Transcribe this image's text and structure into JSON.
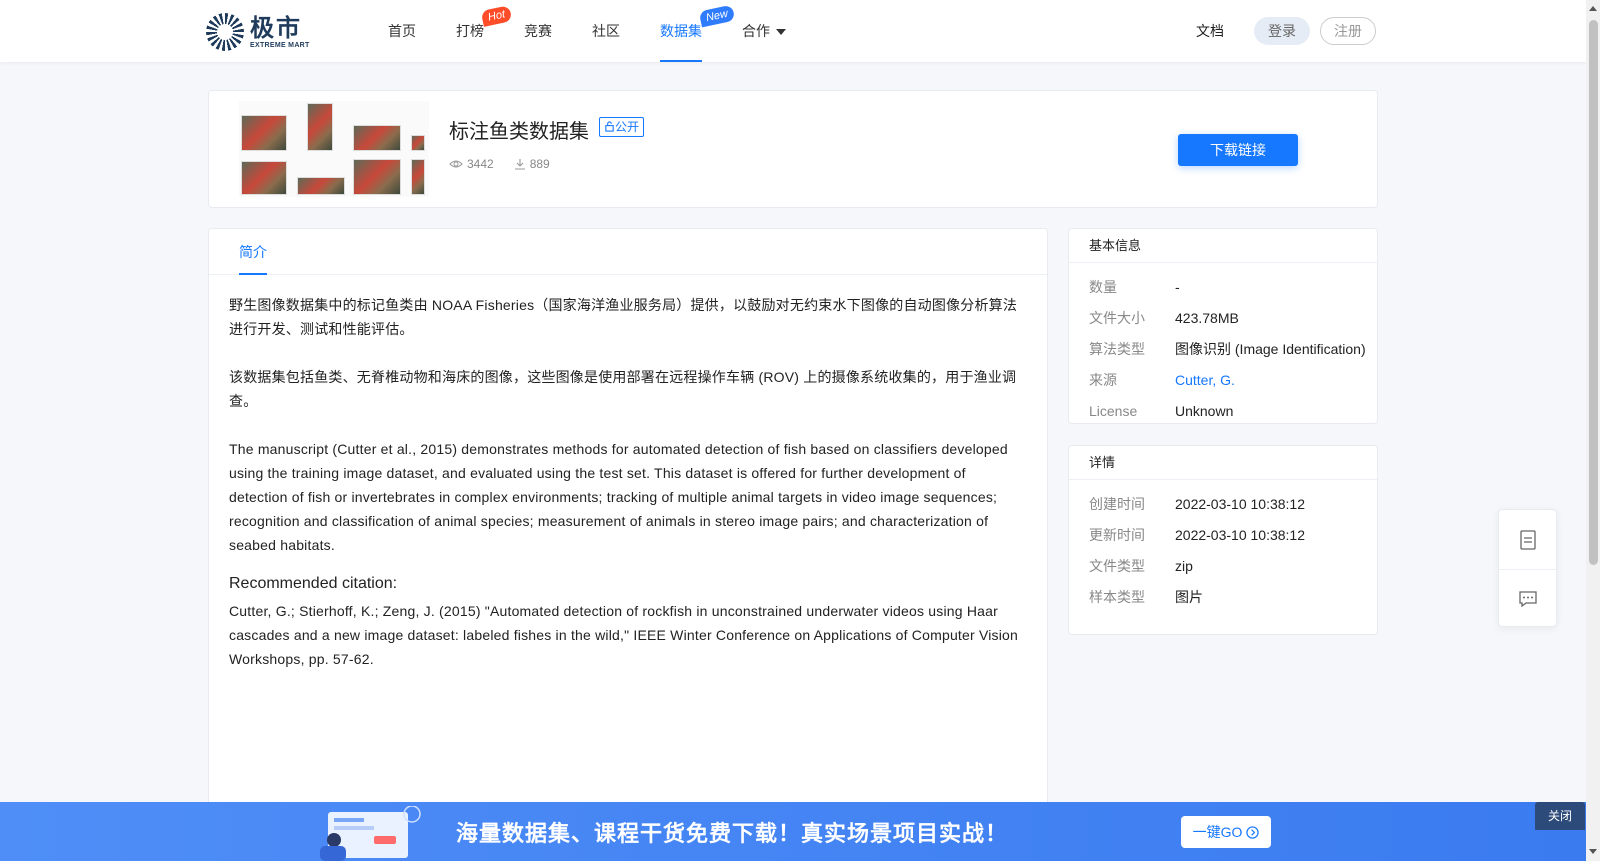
{
  "header": {
    "logo_cn": "极市",
    "logo_en": "EXTREME MART",
    "nav": [
      {
        "label": "首页"
      },
      {
        "label": "打榜",
        "badge": "Hot"
      },
      {
        "label": "竞赛"
      },
      {
        "label": "社区"
      },
      {
        "label": "数据集",
        "badge": "New",
        "active": true
      },
      {
        "label": "合作"
      }
    ],
    "docs": "文档",
    "login": "登录",
    "register": "注册"
  },
  "dataset": {
    "title": "标注鱼类数据集",
    "visibility": "公开",
    "views": "3442",
    "downloads": "889",
    "download_button": "下载链接"
  },
  "tabs": {
    "intro": "简介"
  },
  "content": {
    "p1": "野生图像数据集中的标记鱼类由 NOAA Fisheries（国家海洋渔业服务局）提供，以鼓励对无约束水下图像的自动图像分析算法进行开发、测试和性能评估。",
    "p2": "该数据集包括鱼类、无脊椎动物和海床的图像，这些图像是使用部署在远程操作车辆 (ROV) 上的摄像系统收集的，用于渔业调查。",
    "p3": "The manuscript (Cutter et al., 2015) demonstrates methods for automated detection of fish based on classifiers developed using the training image dataset, and evaluated using the test set. This dataset is offered for further development of detection of fish or invertebrates in complex environments; tracking of multiple animal targets in video image sequences; recognition and classification of animal species; measurement of animals in stereo image pairs; and characterization of seabed habitats.",
    "citation_heading": "Recommended citation:",
    "citation": "Cutter, G.; Stierhoff, K.; Zeng, J. (2015) \"Automated detection of rockfish in unconstrained underwater videos using Haar cascades and a new image dataset: labeled fishes in the wild,\" IEEE Winter Conference on Applications of Computer Vision Workshops, pp. 57-62."
  },
  "basic_info": {
    "title": "基本信息",
    "rows": [
      {
        "k": "数量",
        "v": "-"
      },
      {
        "k": "文件大小",
        "v": "423.78MB"
      },
      {
        "k": "算法类型",
        "v": "图像识别 (Image Identification)"
      },
      {
        "k": "来源",
        "v": "Cutter, G."
      },
      {
        "k": "License",
        "v": "Unknown"
      }
    ]
  },
  "details": {
    "title": "详情",
    "rows": [
      {
        "k": "创建时间",
        "v": "2022-03-10 10:38:12"
      },
      {
        "k": "更新时间",
        "v": "2022-03-10 10:38:12"
      },
      {
        "k": "文件类型",
        "v": "zip"
      },
      {
        "k": "样本类型",
        "v": "图片"
      }
    ]
  },
  "banner": {
    "text": "海量数据集、课程干货免费下载！真实场景项目实战！",
    "go": "一键GO",
    "close": "关闭"
  },
  "colors": {
    "accent": "#1677ff",
    "hot": "#ff4d2a",
    "banner": "#4f8ef7"
  }
}
